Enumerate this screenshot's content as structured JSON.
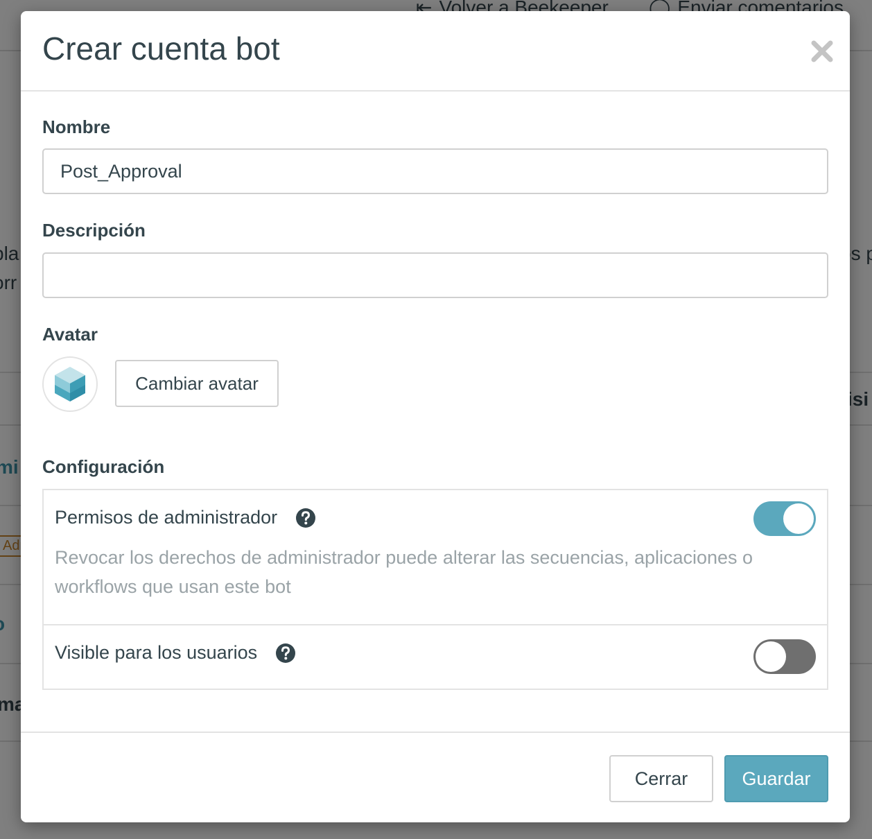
{
  "background": {
    "back_link": "Volver a Beekeeper",
    "feedback_link": "Enviar comentarios",
    "fragments": {
      "left_1": "pla",
      "left_2": "orr",
      "right_1": "os p",
      "right_2": "isi",
      "left_3": "mi",
      "left_4": "Adr",
      "left_5": "o",
      "left_6": "ma"
    }
  },
  "modal": {
    "title": "Crear cuenta bot",
    "close_label": "×",
    "name": {
      "label": "Nombre",
      "value": "Post_Approval"
    },
    "description": {
      "label": "Descripción",
      "value": ""
    },
    "avatar": {
      "label": "Avatar",
      "change_button": "Cambiar avatar"
    },
    "settings": {
      "label": "Configuración",
      "admin": {
        "title": "Permisos de administrador",
        "description": "Revocar los derechos de administrador puede alterar las secuencias, aplicaciones o workflows que usan este bot",
        "enabled": true
      },
      "visible": {
        "title": "Visible para los usuarios",
        "enabled": false
      }
    },
    "footer": {
      "close_button": "Cerrar",
      "save_button": "Guardar"
    }
  },
  "colors": {
    "accent": "#5ba8bd",
    "text": "#34454c",
    "muted": "#9aa3a7",
    "toggle_off": "#6f6f6f"
  },
  "icons": {
    "close": "close-icon",
    "help": "question-circle-icon",
    "avatar": "hexagon-cube-icon",
    "back": "arrow-left-icon",
    "feedback": "chat-bubble-icon"
  }
}
